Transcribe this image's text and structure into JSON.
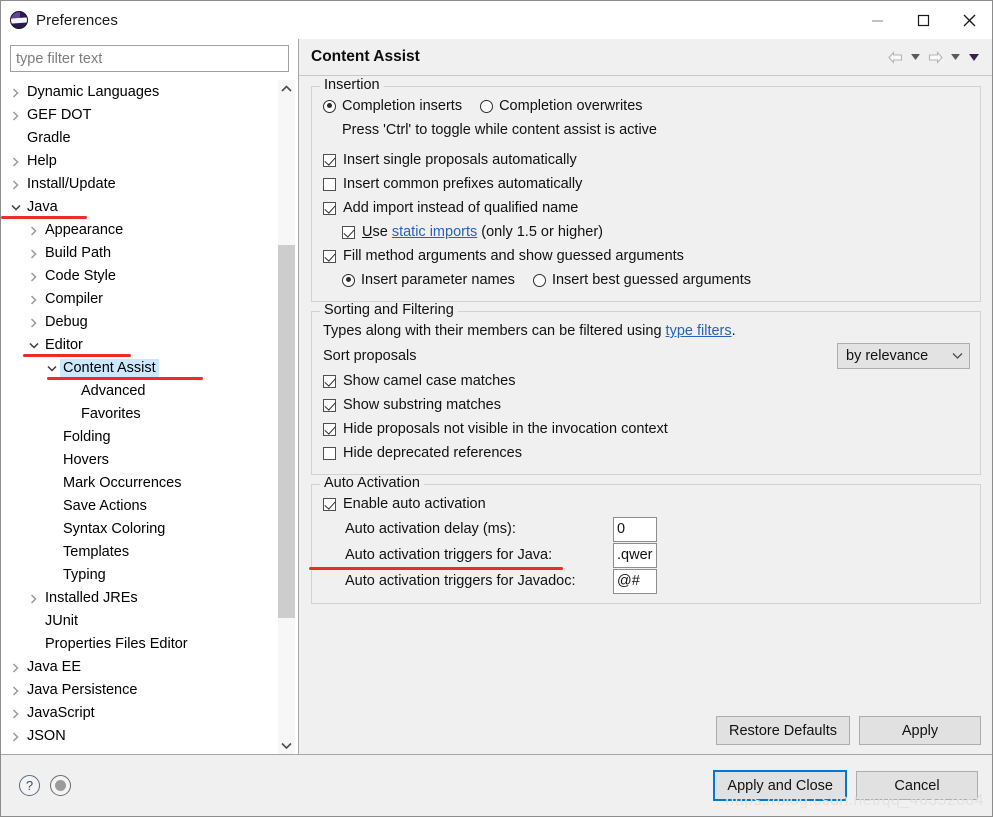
{
  "window": {
    "title": "Preferences",
    "logo_icon": "eclipse-logo-icon",
    "minimize_label": "—",
    "maximize_label": "□",
    "close_label": "✕"
  },
  "sidebar": {
    "filter_placeholder": "type filter text",
    "filter_value": "",
    "items": [
      {
        "label": "Dynamic Languages",
        "level": 0,
        "twisty": "collapsed",
        "selected": false
      },
      {
        "label": "GEF DOT",
        "level": 0,
        "twisty": "collapsed",
        "selected": false
      },
      {
        "label": "Gradle",
        "level": 0,
        "twisty": "none",
        "selected": false
      },
      {
        "label": "Help",
        "level": 0,
        "twisty": "collapsed",
        "selected": false
      },
      {
        "label": "Install/Update",
        "level": 0,
        "twisty": "collapsed",
        "selected": false
      },
      {
        "label": "Java",
        "level": 0,
        "twisty": "expanded",
        "selected": false,
        "annotated": true
      },
      {
        "label": "Appearance",
        "level": 1,
        "twisty": "collapsed",
        "selected": false
      },
      {
        "label": "Build Path",
        "level": 1,
        "twisty": "collapsed",
        "selected": false
      },
      {
        "label": "Code Style",
        "level": 1,
        "twisty": "collapsed",
        "selected": false
      },
      {
        "label": "Compiler",
        "level": 1,
        "twisty": "collapsed",
        "selected": false
      },
      {
        "label": "Debug",
        "level": 1,
        "twisty": "collapsed",
        "selected": false
      },
      {
        "label": "Editor",
        "level": 1,
        "twisty": "expanded",
        "selected": false,
        "annotated": true
      },
      {
        "label": "Content Assist",
        "level": 2,
        "twisty": "expanded",
        "selected": true,
        "annotated": true
      },
      {
        "label": "Advanced",
        "level": 3,
        "twisty": "none",
        "selected": false
      },
      {
        "label": "Favorites",
        "level": 3,
        "twisty": "none",
        "selected": false
      },
      {
        "label": "Folding",
        "level": 2,
        "twisty": "none",
        "selected": false
      },
      {
        "label": "Hovers",
        "level": 2,
        "twisty": "none",
        "selected": false
      },
      {
        "label": "Mark Occurrences",
        "level": 2,
        "twisty": "none",
        "selected": false
      },
      {
        "label": "Save Actions",
        "level": 2,
        "twisty": "none",
        "selected": false
      },
      {
        "label": "Syntax Coloring",
        "level": 2,
        "twisty": "none",
        "selected": false
      },
      {
        "label": "Templates",
        "level": 2,
        "twisty": "none",
        "selected": false
      },
      {
        "label": "Typing",
        "level": 2,
        "twisty": "none",
        "selected": false
      },
      {
        "label": "Installed JREs",
        "level": 1,
        "twisty": "collapsed",
        "selected": false
      },
      {
        "label": "JUnit",
        "level": 1,
        "twisty": "none",
        "selected": false
      },
      {
        "label": "Properties Files Editor",
        "level": 1,
        "twisty": "none",
        "selected": false
      },
      {
        "label": "Java EE",
        "level": 0,
        "twisty": "collapsed",
        "selected": false
      },
      {
        "label": "Java Persistence",
        "level": 0,
        "twisty": "collapsed",
        "selected": false
      },
      {
        "label": "JavaScript",
        "level": 0,
        "twisty": "collapsed",
        "selected": false
      },
      {
        "label": "JSON",
        "level": 0,
        "twisty": "collapsed",
        "selected": false
      }
    ]
  },
  "page": {
    "title": "Content Assist",
    "nav": {
      "back_icon": "arrow-left-icon",
      "back_menu_icon": "chevron-down-icon",
      "forward_icon": "arrow-right-icon",
      "forward_menu_icon": "chevron-down-icon",
      "view_menu_icon": "triangle-down-icon"
    }
  },
  "insertion": {
    "title": "Insertion",
    "completion_inserts": {
      "label": "Completion inserts",
      "checked": true
    },
    "completion_overwrites": {
      "label": "Completion overwrites",
      "checked": false
    },
    "toggle_hint": "Press 'Ctrl' to toggle while content assist is active",
    "insert_single_proposals": {
      "label": "Insert single proposals automatically",
      "checked": true
    },
    "insert_common_prefixes": {
      "label": "Insert common prefixes automatically",
      "checked": false
    },
    "add_import": {
      "label": "Add import instead of qualified name",
      "checked": true
    },
    "use_static_imports": {
      "prefix": "U",
      "prefix_rest": "se ",
      "link": "static imports",
      "suffix": " (only 1.5 or higher)",
      "checked": true
    },
    "fill_method_arguments": {
      "label": "Fill method arguments and show guessed arguments",
      "checked": true
    },
    "insert_parameter_names": {
      "label": "Insert parameter names",
      "checked": true
    },
    "insert_best_guessed": {
      "label": "Insert best guessed arguments",
      "checked": false
    }
  },
  "sorting": {
    "title": "Sorting and Filtering",
    "filter_text_prefix": "Types along with their members can be filtered using ",
    "filter_link": "type filters",
    "filter_text_suffix": ".",
    "sort_label": "Sort proposals",
    "sort_value": "by relevance",
    "sort_chevron_icon": "chevron-down-icon",
    "show_camel_case": {
      "label": "Show camel case matches",
      "checked": true
    },
    "show_substring": {
      "label": "Show substring matches",
      "checked": true
    },
    "hide_not_visible": {
      "label": "Hide proposals not visible in the invocation context",
      "checked": true
    },
    "hide_deprecated": {
      "label": "Hide deprecated references",
      "checked": false
    }
  },
  "auto_activation": {
    "title": "Auto Activation",
    "enable": {
      "label": "Enable auto activation",
      "checked": true
    },
    "delay_label": "Auto activation delay (ms):",
    "delay_value": "0",
    "java_triggers_label": "Auto activation triggers for Java:",
    "java_triggers_value": ".qwer",
    "javadoc_triggers_label": "Auto activation triggers for Javadoc:",
    "javadoc_triggers_value": "@#"
  },
  "page_buttons": {
    "restore_defaults": "Restore Defaults",
    "apply": "Apply"
  },
  "footer": {
    "help_icon": "question-mark-icon",
    "help_label": "?",
    "secondary_icon": "eclipse-dot-icon",
    "apply_and_close": "Apply and Close",
    "cancel": "Cancel",
    "watermark": "https://blog.csdn.net/qq_46352684"
  },
  "colors": {
    "selection": "#cce8ff",
    "annotation_red": "#ee2b26",
    "link": "#2763b3",
    "focus_blue": "#0078d7",
    "dialog_bg": "#f0f0f0"
  }
}
